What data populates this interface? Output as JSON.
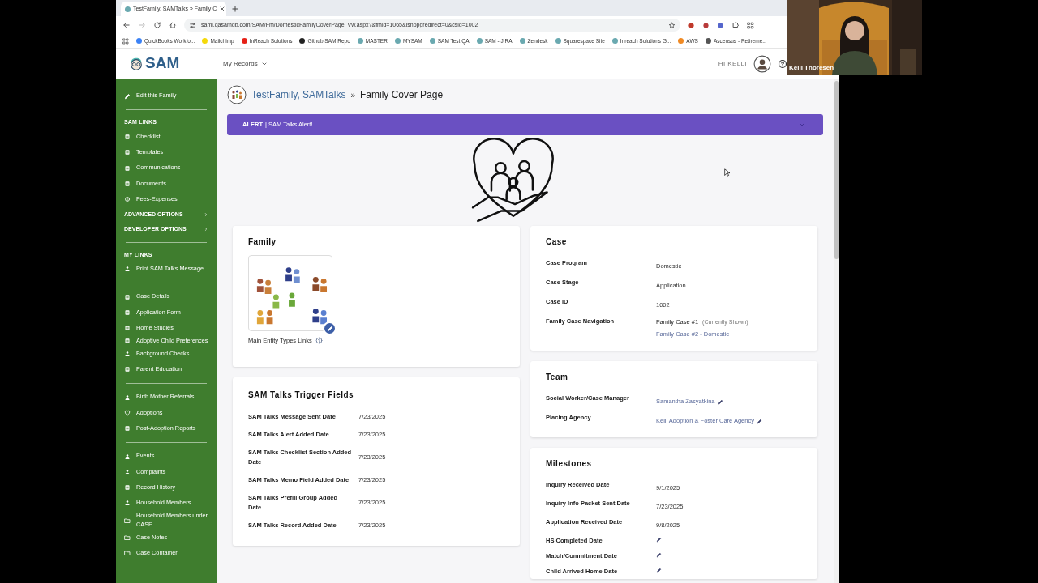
{
  "browser": {
    "tab_title": "TestFamily, SAMTalks » Family C",
    "url": "sami.qasamdb.com/SAM/Fm/DomesticFamilyCoverPage_Vw.aspx?&fmid=1065&isnopgredirect=0&csid=1002",
    "bookmarks": [
      {
        "label": "QuickBooks Workfo...",
        "color": "#3b82f6"
      },
      {
        "label": "Mailchimp",
        "color": "#f5d90a"
      },
      {
        "label": "InReach Solutions",
        "color": "#e62117"
      },
      {
        "label": "Github SAM Repo",
        "color": "#222222"
      },
      {
        "label": "MASTER",
        "color": "#6aa9b0"
      },
      {
        "label": "MYSAM",
        "color": "#6aa9b0"
      },
      {
        "label": "SAM Test QA",
        "color": "#6aa9b0"
      },
      {
        "label": "SAM - JIRA",
        "color": "#6aa9b0"
      },
      {
        "label": "Zendesk",
        "color": "#6aa9b0"
      },
      {
        "label": "Squarespace Site",
        "color": "#6aa9b0"
      },
      {
        "label": "Inreach Solutions G...",
        "color": "#6aa9b0"
      },
      {
        "label": "AWS",
        "color": "#f08a24"
      },
      {
        "label": "Ascensus - Retireme...",
        "color": "#555555"
      }
    ]
  },
  "webcam": {
    "name": "Kelli Thoresen"
  },
  "header": {
    "logo": "SAM",
    "menu": "My Records",
    "greeting": "HI KELLI"
  },
  "sidebar": {
    "groups": [
      {
        "items": [
          {
            "label": "Edit this Family",
            "kind": "link"
          }
        ]
      },
      {
        "heading": "SAM LINKS",
        "items": [
          {
            "label": "Checklist",
            "kind": "link"
          },
          {
            "label": "Templates",
            "kind": "link"
          },
          {
            "label": "Communications",
            "kind": "link"
          },
          {
            "label": "Documents",
            "kind": "link"
          },
          {
            "label": "Fees-Expenses",
            "kind": "link"
          },
          {
            "label": "ADVANCED OPTIONS",
            "kind": "expander"
          },
          {
            "label": "DEVELOPER OPTIONS",
            "kind": "expander"
          }
        ]
      },
      {
        "heading": "MY LINKS",
        "items": [
          {
            "label": "Print SAM Talks Message",
            "kind": "link"
          }
        ]
      },
      {
        "items": [
          {
            "label": "Case Details",
            "kind": "link"
          },
          {
            "label": "Application Form",
            "kind": "link"
          },
          {
            "label": "Home Studies",
            "kind": "link"
          },
          {
            "label": "Adoptive Child Preferences",
            "kind": "link"
          },
          {
            "label": "Background Checks",
            "kind": "link"
          },
          {
            "label": "Parent Education",
            "kind": "link"
          }
        ]
      },
      {
        "items": [
          {
            "label": "Birth Mother Referrals",
            "kind": "link"
          },
          {
            "label": "Adoptions",
            "kind": "link"
          },
          {
            "label": "Post-Adoption Reports",
            "kind": "link"
          }
        ]
      },
      {
        "items": [
          {
            "label": "Events",
            "kind": "link"
          },
          {
            "label": "Complaints",
            "kind": "link"
          },
          {
            "label": "Record History",
            "kind": "link"
          },
          {
            "label": "Household Members",
            "kind": "link"
          },
          {
            "label": "Household Members under CASE",
            "kind": "link"
          },
          {
            "label": "Case Notes",
            "kind": "link"
          },
          {
            "label": "Case Container",
            "kind": "link"
          }
        ]
      }
    ]
  },
  "breadcrumb": {
    "family": "TestFamily, SAMTalks",
    "separator": "»",
    "page": "Family Cover Page"
  },
  "alert": {
    "tag": "ALERT",
    "text": "| SAM Talks Alert!",
    "expanded": false
  },
  "family_card": {
    "title": "Family",
    "links_label": "Main Entity Types Links"
  },
  "trigger_card": {
    "title": "SAM Talks Trigger Fields",
    "rows": [
      {
        "label": "SAM Talks Message Sent Date",
        "value": "7/23/2025"
      },
      {
        "label": "SAM Talks Alert Added Date",
        "value": "7/23/2025"
      },
      {
        "label": "SAM Talks Checklist Section Added Date",
        "value": "7/23/2025"
      },
      {
        "label": "SAM Talks Memo Field Added Date",
        "value": "7/23/2025"
      },
      {
        "label": "SAM Talks Prefill Group Added Date",
        "value": "7/23/2025"
      },
      {
        "label": "SAM Talks Record Added Date",
        "value": "7/23/2025"
      }
    ]
  },
  "case_card": {
    "title": "Case",
    "rows": [
      {
        "label": "Case Program",
        "kind": "text",
        "value": "Domestic"
      },
      {
        "label": "Case Stage",
        "kind": "text",
        "value": "Application"
      },
      {
        "label": "Case ID",
        "kind": "text",
        "value": "1002"
      },
      {
        "label": "Family Case Navigation",
        "kind": "navigation",
        "current": "Family Case #1",
        "note": "(Currently Shown)",
        "link": "Family Case #2 - Domestic"
      }
    ]
  },
  "team_card": {
    "title": "Team",
    "rows": [
      {
        "label": "Social Worker/Case Manager",
        "kind": "link_edit",
        "value": "Samantha Zasyatkina"
      },
      {
        "label": "Placing Agency",
        "kind": "link_edit",
        "value": "Kelli Adoption & Foster Care Agency"
      }
    ]
  },
  "milestones_card": {
    "title": "Milestones",
    "rows": [
      {
        "label": "Inquiry Received Date",
        "kind": "text",
        "value": "9/1/2025"
      },
      {
        "label": "Inquiry Info Packet Sent Date",
        "kind": "text",
        "value": "7/23/2025"
      },
      {
        "label": "Application Received Date",
        "kind": "text",
        "value": "9/8/2025"
      },
      {
        "label": "HS Completed Date",
        "kind": "edit"
      },
      {
        "label": "Match/Commitment Date",
        "kind": "edit"
      },
      {
        "label": "Child Arrived Home Date",
        "kind": "edit"
      }
    ]
  }
}
